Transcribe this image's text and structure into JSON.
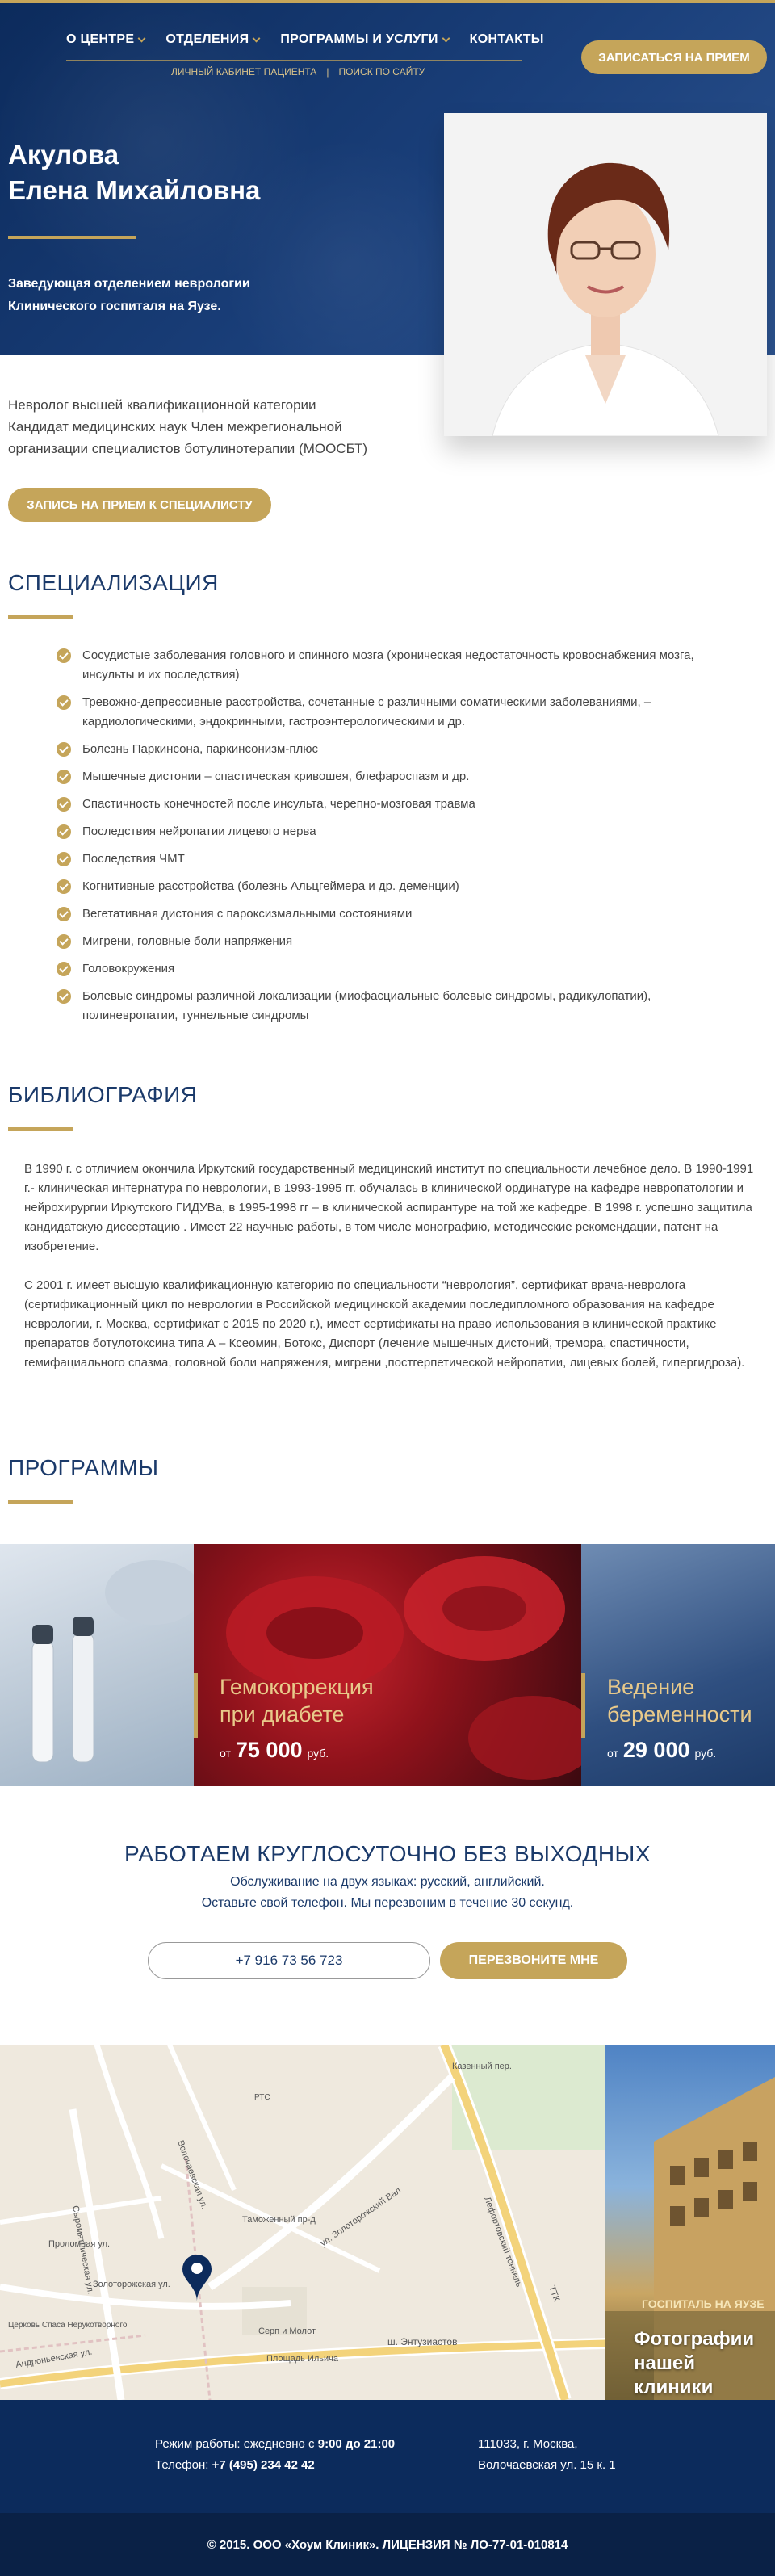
{
  "nav": {
    "items": [
      {
        "label": "О ЦЕНТРЕ",
        "dropdown": true
      },
      {
        "label": "ОТДЕЛЕНИЯ",
        "dropdown": true
      },
      {
        "label": "ПРОГРАММЫ И УСЛУГИ",
        "dropdown": true
      },
      {
        "label": "КОНТАКТЫ",
        "dropdown": false
      }
    ],
    "subnav": [
      "ЛИЧНЫЙ КАБИНЕТ ПАЦИЕНТА",
      "ПОИСК ПО САЙТУ"
    ],
    "subnav_sep": "|",
    "cta": "ЗАПИСАТЬСЯ НА ПРИЕМ"
  },
  "doctor": {
    "name_line1": "Акулова",
    "name_line2": "Елена Михайловна",
    "role_line1": "Заведующая отделением неврологии",
    "role_line2": "Клинического госпиталя на Яузе.",
    "qual_line1": "Невролог высшей квалификационной категории",
    "qual_line2": "Кандидат медицинских наук Член межрегиональной",
    "qual_line3": "организации специалистов ботулинотерапии (МООСБТ)",
    "appoint_button": "ЗАПИСЬ НА ПРИЕМ К СПЕЦИАЛИСТУ"
  },
  "specialization": {
    "title": "СПЕЦИАЛИЗАЦИЯ",
    "items": [
      "Сосудистые заболевания головного и спинного мозга (хроническая недостаточность кровоснабжения мозга, инсульты и их последствия)",
      "Тревожно-депрессивные расстройства, сочетанные с различными соматическими заболеваниями, – кардиологическими, эндокринными, гастроэнтерологическими и др.",
      "Болезнь Паркинсона, паркинсонизм-плюс",
      "Мышечные дистонии – спастическая кривошея, блефароспазм и др.",
      "Спастичность конечностей после инсульта, черепно-мозговая травма",
      "Последствия нейропатии лицевого нерва",
      "Последствия ЧМТ",
      "Когнитивные расстройства (болезнь Альцгеймера и др. деменции)",
      "Вегетативная дистония с пароксизмальными состояниями",
      "Мигрени, головные боли напряжения",
      "Головокружения",
      "Болевые синдромы различной локализации (миофасциальные болевые синдромы, радикулопатии), полиневропатии, туннельные синдромы"
    ]
  },
  "bibliography": {
    "title": "БИБЛИОГРАФИЯ",
    "p1": "В 1990 г. с отличием окончила Иркутский государственный медицинский институт по специальности лечебное дело. В 1990-1991 г.- клиническая интернатура по неврологии, в 1993-1995 гг. обучалась в клинической ординатуре на кафедре невропатологии и нейрохирургии Иркутского ГИДУВа, в 1995-1998 гг – в клинической аспирантуре на той же кафедре. В 1998 г. успешно защитила кандидатскую диссертацию . Имеет 22 научные работы, в том числе монографию, методические рекомендации, патент на изобретение.",
    "p2": "С 2001 г. имеет высшую квалификационную категорию по специальности “неврология”, сертификат врача-невролога (сертификационный цикл по неврологии в Российской медицинской академии последипломного образования на кафедре неврологии, г. Москва, сертификат с 2015 по 2020 г.), имеет сертификаты на право использования в клинической практике препаратов ботулотоксина типа А – Ксеомин, Ботокс, Диспорт (лечение мышечных дистоний, тремора, спастичности, гемифациального спазма, головной боли напряжения, мигрени ,постгерпетической нейропатии, лицевых болей, гипергидроза)."
  },
  "programs": {
    "title": "ПРОГРАММЫ",
    "items": [
      {
        "title_line1": "Гемокоррекция",
        "title_line2": "при диабете",
        "price_prefix": "от",
        "price": "75 000",
        "currency": "руб."
      },
      {
        "title_line1": "Ведение",
        "title_line2": "беременности",
        "price_prefix": "от",
        "price": "29 000",
        "currency": "руб."
      }
    ]
  },
  "callback": {
    "title": "РАБОТАЕМ КРУГЛОСУТОЧНО БЕЗ ВЫХОДНЫХ",
    "line1": "Обслуживание на двух языках: русский, английский.",
    "line2": "Оставьте свой телефон. Мы перезвоним в течение 30 секунд.",
    "phone_value": "+7 916 73 56 723",
    "button": "ПЕРЕЗВОНИТЕ МНЕ"
  },
  "map": {
    "labels": [
      "Казенный пер.",
      "Таможенный пр-д",
      "ул. Золоторожский Вал",
      "Лефортовский тоннель",
      "ш. Энтузиастов",
      "Сыромятническая ул.",
      "Золоторожская ул.",
      "Волочаевская ул.",
      "Площадь Ильича",
      "Серп и Молот",
      "ТТК",
      "Церковь Спаса Нерукотворного",
      "Андроньевская ул.",
      "Проломная ул.",
      "РТС"
    ],
    "clinic_photo_label_line1": "Фотографии",
    "clinic_photo_label_line2": "нашей клиники",
    "building_sign": "ГОСПИТАЛЬ НА ЯУЗЕ"
  },
  "footer": {
    "hours_label": "Режим работы: ежедневно с",
    "hours_value": "9:00 до 21:00",
    "phone_label": "Телефон:",
    "phone_value": "+7 (495) 234 42 42",
    "address_line1": "111033, г. Москва,",
    "address_line2": "Волочаевская ул. 15 к. 1",
    "copyright": "© 2015. ООО «Хоум Клиник». ЛИЦЕНЗИЯ № ЛО-77-01-010814"
  },
  "colors": {
    "navy": "#0c2b5c",
    "gold": "#c5a55a",
    "title_blue": "#1b3a6a"
  }
}
